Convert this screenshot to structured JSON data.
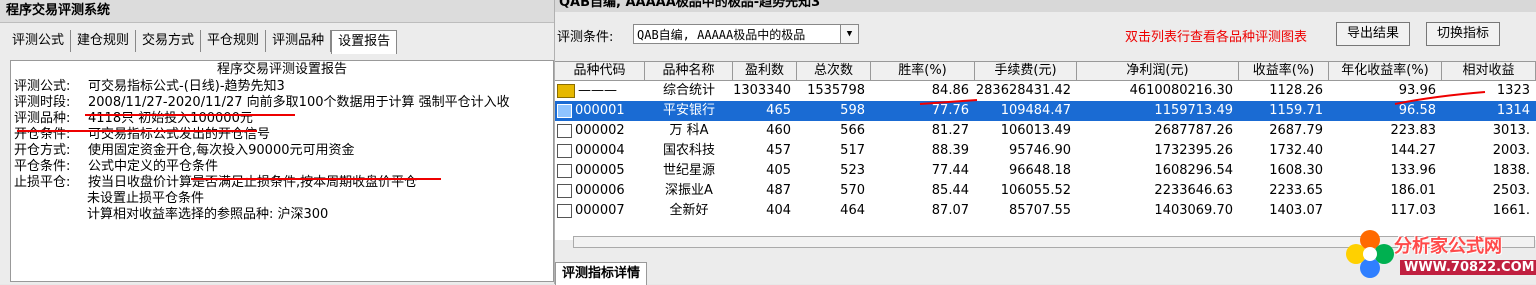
{
  "left": {
    "title": "程序交易评测系统",
    "tabs": [
      "评测公式",
      "建仓规则",
      "交易方式",
      "平仓规则",
      "评测品种",
      "设置报告"
    ],
    "active_tab": "设置报告",
    "report": {
      "title": "程序交易评测设置报告",
      "rows": [
        {
          "k": "评测公式:",
          "v": "可交易指标公式-(日线)-趋势先知3"
        },
        {
          "k": "评测时段:",
          "v": "2008/11/27-2020/11/27 向前多取100个数据用于计算 强制平仓计入收"
        },
        {
          "k": "评测品种:",
          "v": "4118只 初始投入100000元"
        },
        {
          "k": "开仓条件:",
          "v": "可交易指标公式发出的开仓信号"
        },
        {
          "k": "开仓方式:",
          "v": "使用固定资金开仓,每次投入90000元可用资金"
        },
        {
          "k": "平仓条件:",
          "v": "公式中定义的平仓条件"
        },
        {
          "k": "止损平仓:",
          "v": "按当日收盘价计算是否满足止损条件,按本周期收盘价平仓"
        }
      ],
      "indent_rows": [
        "未设置止损平仓条件",
        "计算相对收益率选择的参照品种: 沪深300"
      ]
    }
  },
  "right": {
    "title": "QAB自编, AAAAA极品中的极品-趋势先知3",
    "cond_label": "评测条件:",
    "combo_value": "QAB自编, AAAAA极品中的极品",
    "hint": "双击列表行查看各品种评测图表",
    "export_btn": "导出结果",
    "switch_btn": "切换指标",
    "columns": [
      "品种代码",
      "品种名称",
      "盈利数",
      "总次数",
      "胜率(%)",
      "手续费(元)",
      "净利润(元)",
      "收益率(%)",
      "年化收益率(%)",
      "相对收益"
    ],
    "rows": [
      [
        "———",
        "综合统计",
        "1303340",
        "1535798",
        "84.86",
        "283628431.42",
        "4610080216.30",
        "1128.26",
        "93.96",
        "1323"
      ],
      [
        "000001",
        "平安银行",
        "465",
        "598",
        "77.76",
        "109484.47",
        "1159713.49",
        "1159.71",
        "96.58",
        "1314"
      ],
      [
        "000002",
        "万 科A",
        "460",
        "566",
        "81.27",
        "106013.49",
        "2687787.26",
        "2687.79",
        "223.83",
        "3013."
      ],
      [
        "000004",
        "国农科技",
        "457",
        "517",
        "88.39",
        "95746.90",
        "1732395.26",
        "1732.40",
        "144.27",
        "2003."
      ],
      [
        "000005",
        "世纪星源",
        "405",
        "523",
        "77.44",
        "96648.18",
        "1608296.54",
        "1608.30",
        "133.96",
        "1838."
      ],
      [
        "000006",
        "深振业A",
        "487",
        "570",
        "85.44",
        "106055.52",
        "2233646.63",
        "2233.65",
        "186.01",
        "2503."
      ],
      [
        "000007",
        "全新好",
        "404",
        "464",
        "87.07",
        "85707.55",
        "1403069.70",
        "1403.07",
        "117.03",
        "1661."
      ]
    ],
    "bottom_tab": "评测指标详情"
  },
  "watermark": {
    "line1": "分析家公式网",
    "line2": "WWW.70822.COM"
  },
  "colors": {
    "accent_red": "#e00000",
    "selection_blue": "#1a6bd3"
  }
}
